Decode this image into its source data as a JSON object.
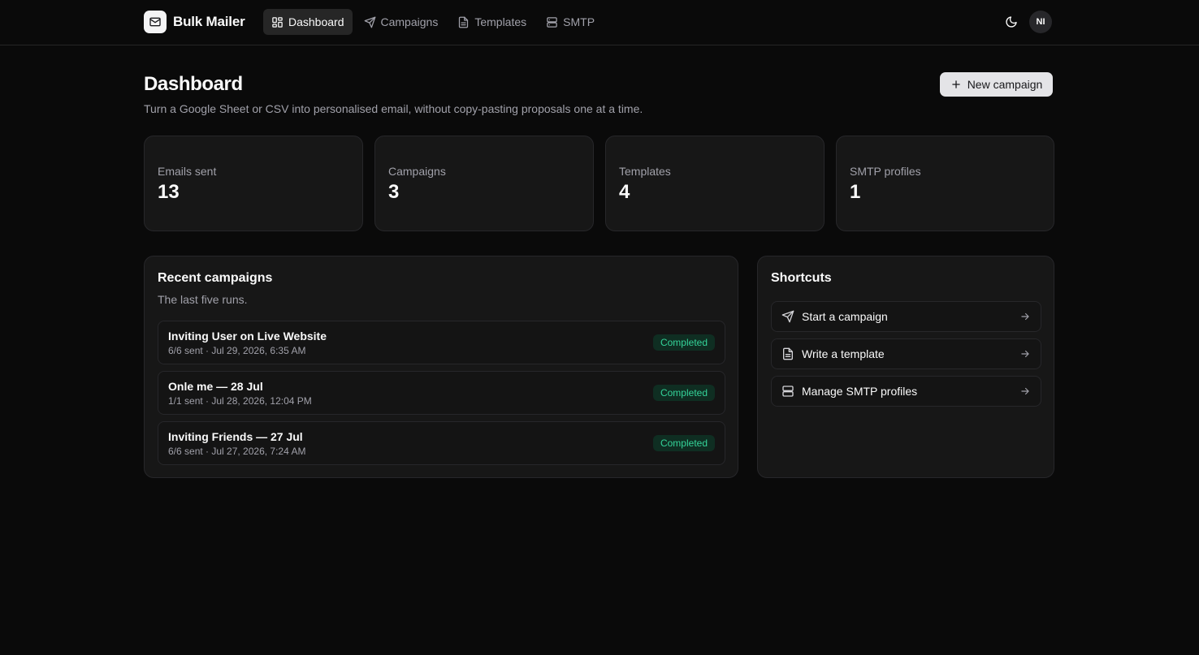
{
  "app": {
    "name": "Bulk Mailer"
  },
  "nav": {
    "items": [
      {
        "label": "Dashboard",
        "icon": "dashboard-grid-icon",
        "active": true
      },
      {
        "label": "Campaigns",
        "icon": "send-icon",
        "active": false
      },
      {
        "label": "Templates",
        "icon": "document-icon",
        "active": false
      },
      {
        "label": "SMTP",
        "icon": "server-icon",
        "active": false
      }
    ]
  },
  "header": {
    "theme_icon": "moon-icon",
    "avatar_initials": "NI"
  },
  "page": {
    "title": "Dashboard",
    "subtitle": "Turn a Google Sheet or CSV into personalised email, without copy-pasting proposals one at a time.",
    "new_campaign_label": "New campaign"
  },
  "stats": [
    {
      "label": "Emails sent",
      "value": "13"
    },
    {
      "label": "Campaigns",
      "value": "3"
    },
    {
      "label": "Templates",
      "value": "4"
    },
    {
      "label": "SMTP profiles",
      "value": "1"
    }
  ],
  "recent": {
    "title": "Recent campaigns",
    "subtitle": "The last five runs.",
    "items": [
      {
        "name": "Inviting User on Live Website",
        "meta": "6/6 sent · Jul 29, 2026, 6:35 AM",
        "status": "Completed"
      },
      {
        "name": "Onle me — 28 Jul",
        "meta": "1/1 sent · Jul 28, 2026, 12:04 PM",
        "status": "Completed"
      },
      {
        "name": "Inviting Friends — 27 Jul",
        "meta": "6/6 sent · Jul 27, 2026, 7:24 AM",
        "status": "Completed"
      }
    ]
  },
  "shortcuts": {
    "title": "Shortcuts",
    "items": [
      {
        "label": "Start a campaign",
        "icon": "send-icon"
      },
      {
        "label": "Write a template",
        "icon": "document-icon"
      },
      {
        "label": "Manage SMTP profiles",
        "icon": "server-icon"
      }
    ]
  },
  "colors": {
    "background": "#0a0a0a",
    "card": "#171717",
    "border": "#27272a",
    "muted_text": "#a1a1aa",
    "status_completed": "#34d399"
  }
}
